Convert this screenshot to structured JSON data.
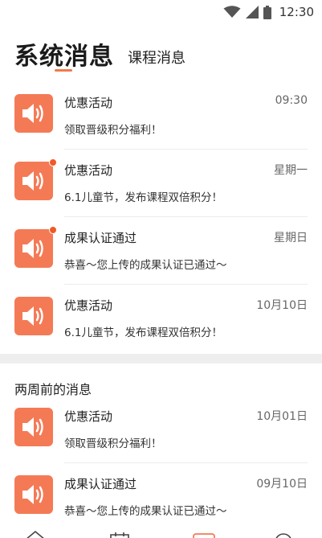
{
  "status_bar": {
    "time": "12:30",
    "icons": [
      "wifi-icon",
      "signal-icon",
      "battery-icon"
    ]
  },
  "tabs": {
    "system": "系统消息",
    "course": "课程消息",
    "active": "system"
  },
  "accent_color": "#f47a55",
  "unread_dot_color": "#f15a24",
  "messages": [
    {
      "title": "优惠活动",
      "time": "09:30",
      "body": "领取晋级积分福利！",
      "unread": false,
      "icon": "speaker-icon"
    },
    {
      "title": "优惠活动",
      "time": "星期一",
      "body": "6.1儿童节，发布课程双倍积分！",
      "unread": true,
      "icon": "speaker-icon"
    },
    {
      "title": "成果认证通过",
      "time": "星期日",
      "body": "恭喜～您上传的成果认证已通过～",
      "unread": true,
      "icon": "speaker-icon"
    },
    {
      "title": "优惠活动",
      "time": "10月10日",
      "body": "6.1儿童节，发布课程双倍积分！",
      "unread": false,
      "icon": "speaker-icon"
    }
  ],
  "history": {
    "title": "两周前的消息",
    "messages": [
      {
        "title": "优惠活动",
        "time": "10月01日",
        "body": "领取晋级积分福利！",
        "unread": false,
        "icon": "speaker-icon"
      },
      {
        "title": "成果认证通过",
        "time": "09月10日",
        "body": "恭喜～您上传的成果认证已通过～",
        "unread": false,
        "icon": "speaker-icon"
      }
    ]
  },
  "bottom_nav": {
    "items": [
      "home-icon",
      "course-icon",
      "message-icon",
      "profile-icon"
    ],
    "active": "message-icon"
  }
}
